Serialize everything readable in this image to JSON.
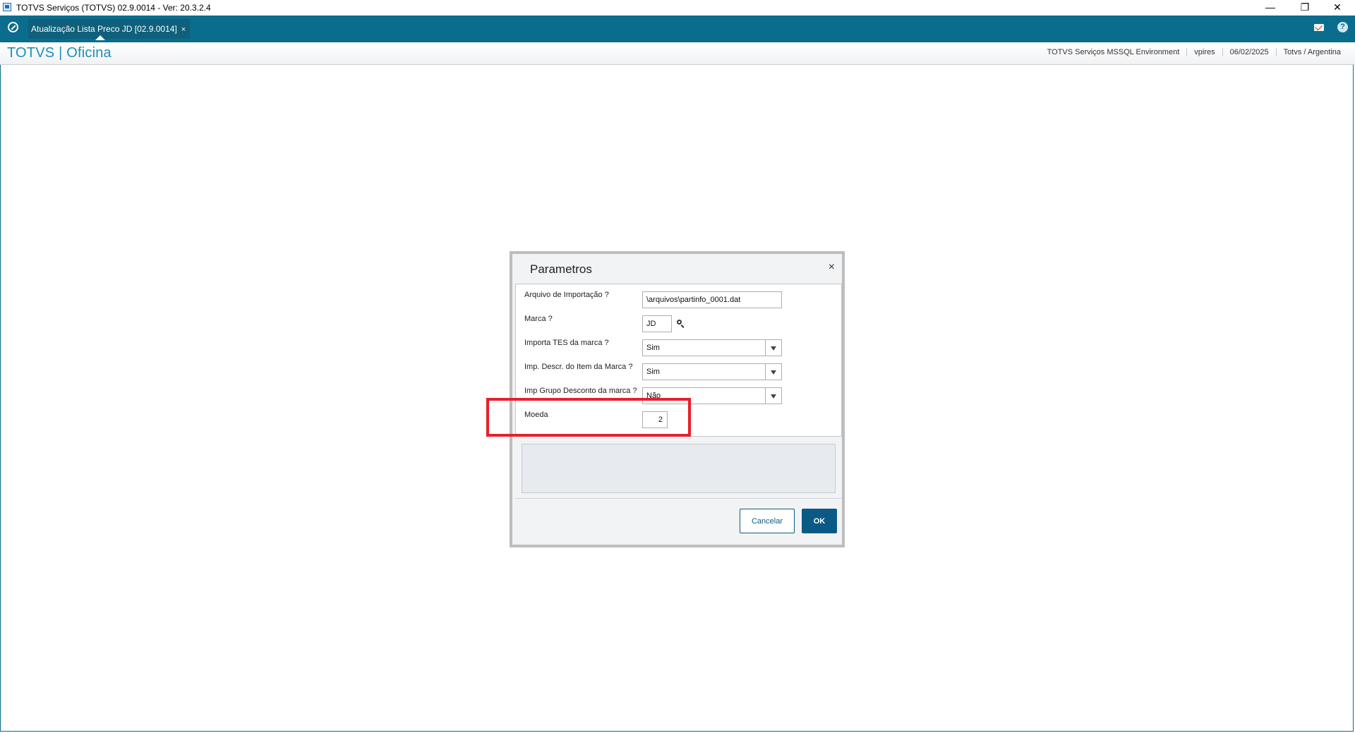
{
  "window": {
    "title": "TOTVS Serviços (TOTVS) 02.9.0014 - Ver: 20.3.2.4",
    "minimize": "—",
    "restore": "❐",
    "close": "✕"
  },
  "tabbar": {
    "tab_label": "Atualização Lista Preco JD [02.9.0014]",
    "tab_close": "×",
    "help": "?"
  },
  "header": {
    "brand": "TOTVS | Oficina",
    "environment": "TOTVS Serviços MSSQL Environment",
    "user": "vpires",
    "date": "06/02/2025",
    "company": "Totvs / Argentina"
  },
  "dialog": {
    "title": "Parametros",
    "close": "×",
    "fields": [
      {
        "label": "Arquivo de Importação ?",
        "value": "\\arquivos\\partinfo_0001.dat"
      },
      {
        "label": "Marca ?",
        "value": "JD"
      },
      {
        "label": "Importa TES da marca ?",
        "value": "Sim"
      },
      {
        "label": "Imp. Descr. do Item da Marca ?",
        "value": "Sim"
      },
      {
        "label": "Imp Grupo Desconto da marca ?",
        "value": "Não"
      },
      {
        "label": "Moeda",
        "value": "2"
      }
    ],
    "cancel_label": "Cancelar",
    "ok_label": "OK"
  },
  "colors": {
    "tabbar": "#0b6d8d",
    "brand": "#1b8fb9",
    "primary_button": "#0b5a86",
    "highlight": "#e8202a"
  }
}
